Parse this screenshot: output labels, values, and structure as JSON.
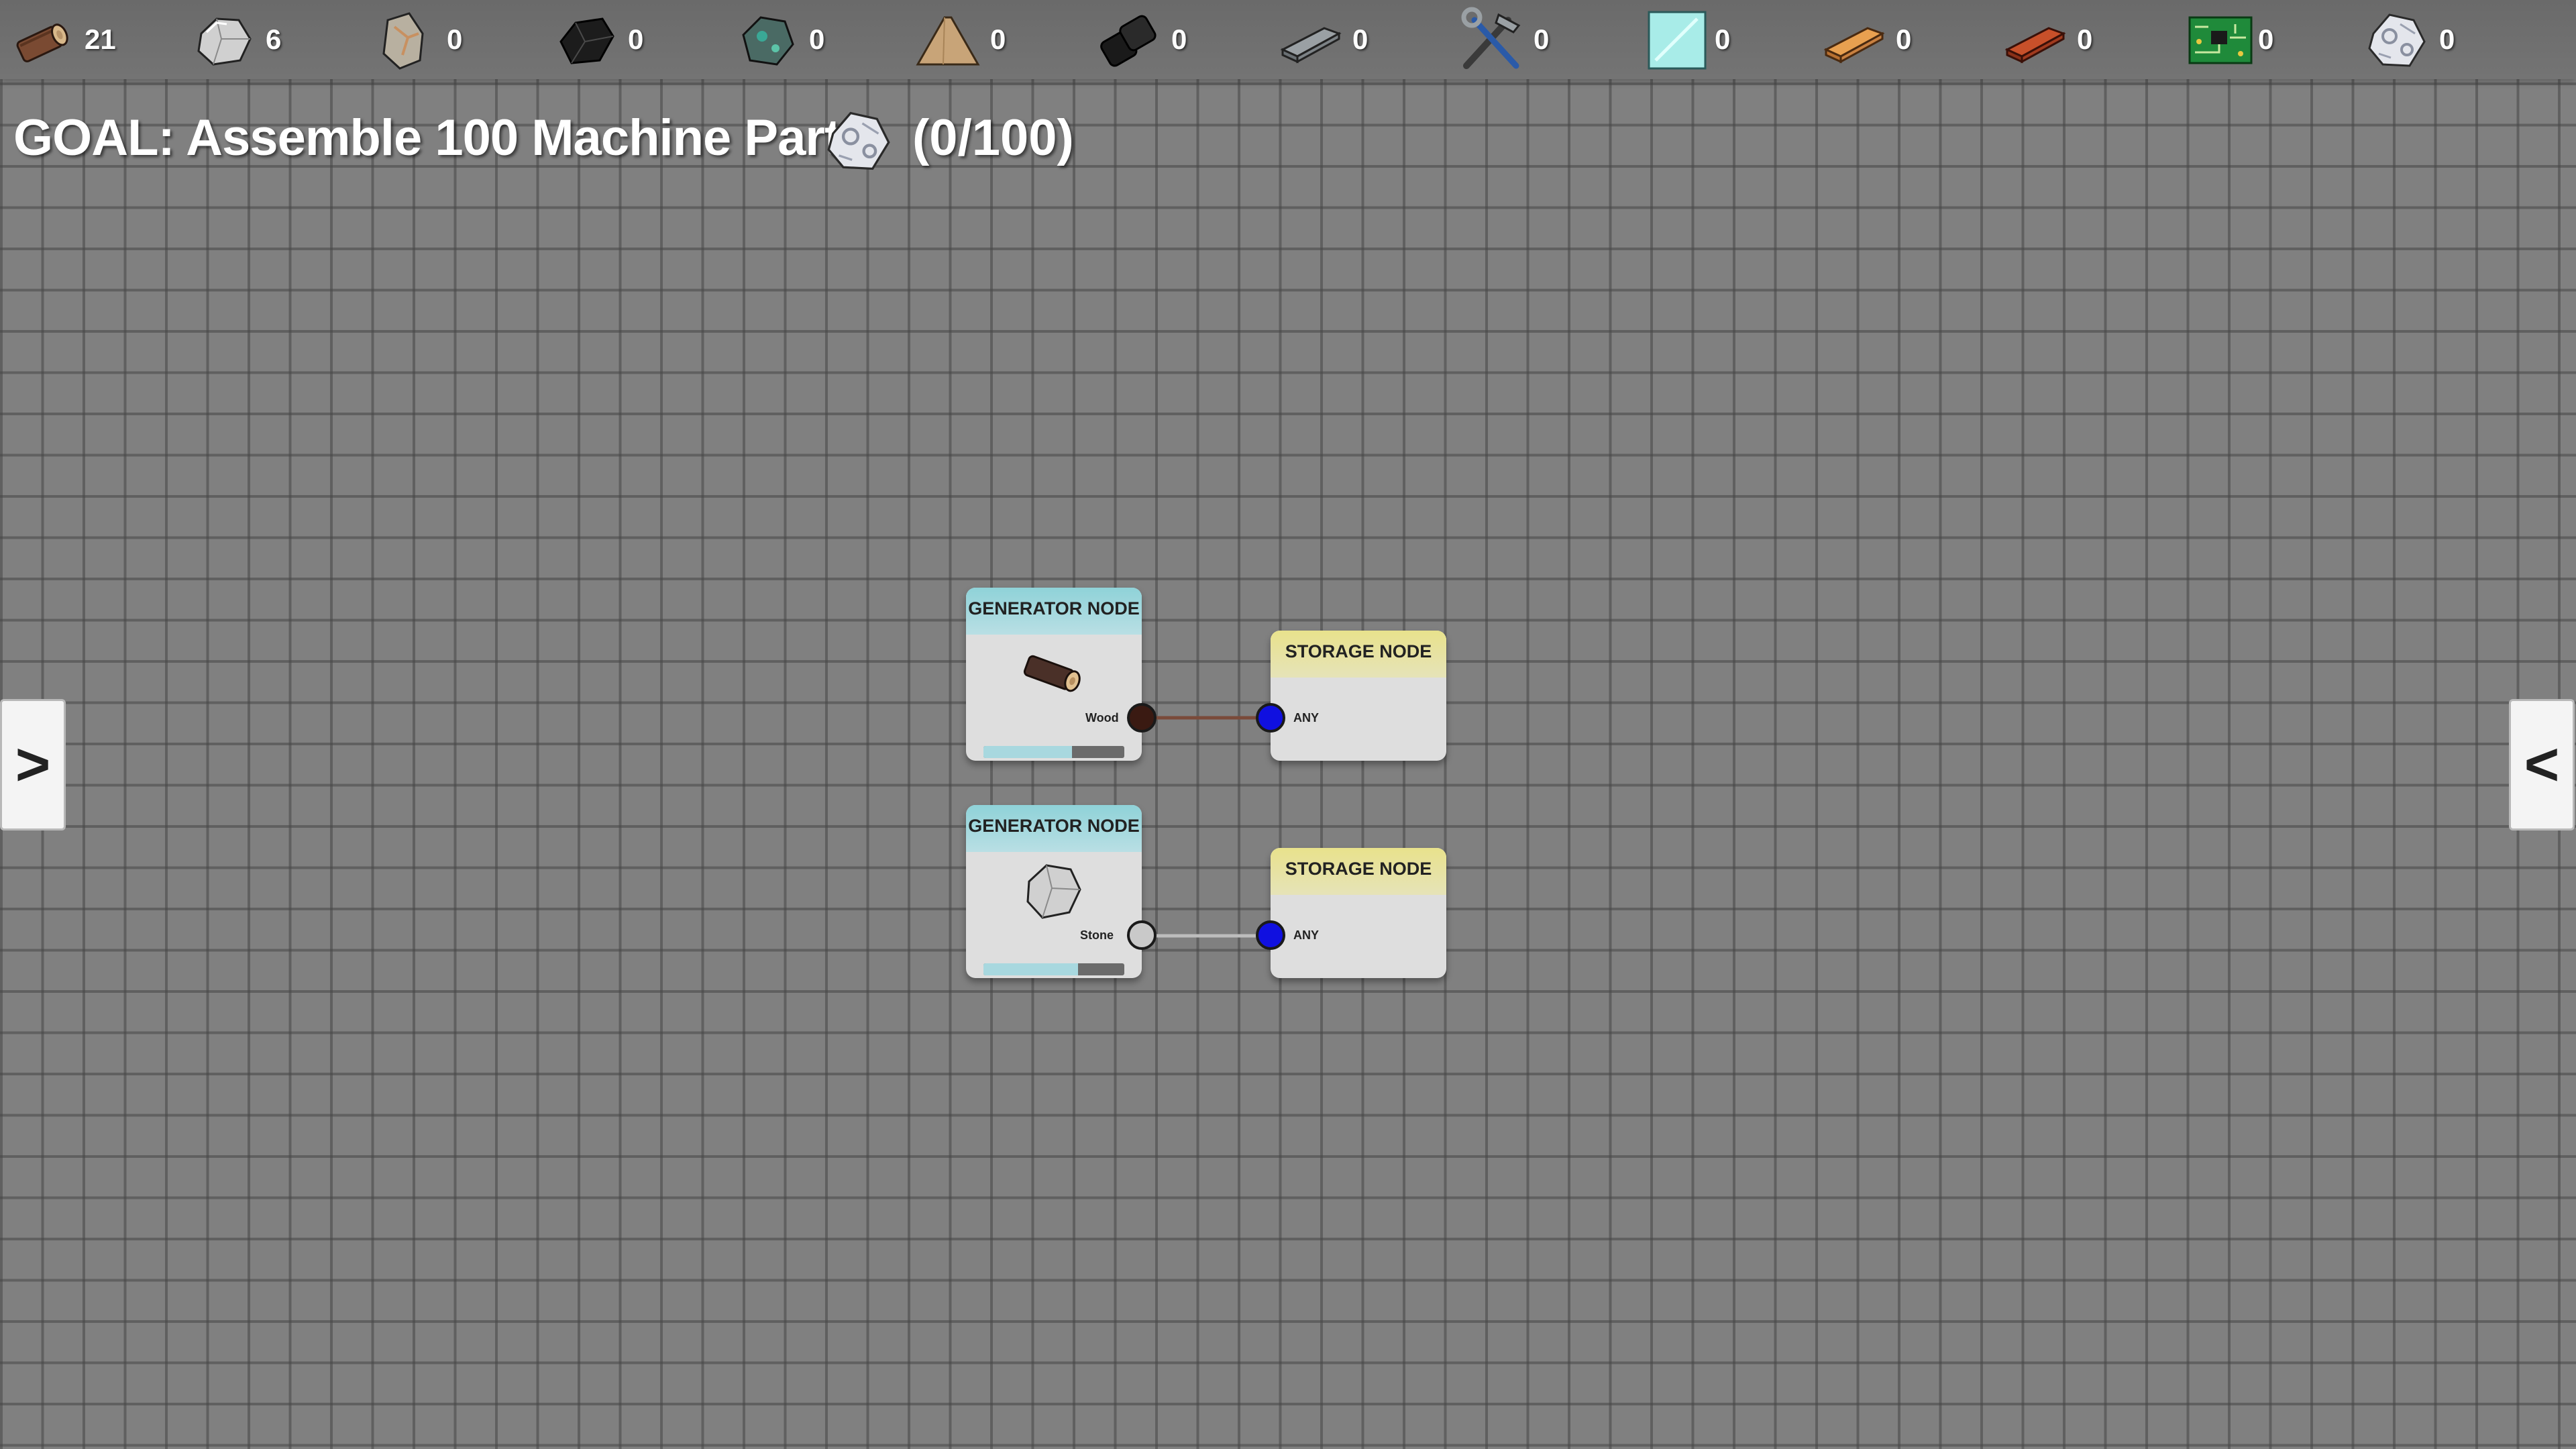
{
  "resources": [
    {
      "name": "wood-icon",
      "count": "21"
    },
    {
      "name": "stone-icon",
      "count": "6"
    },
    {
      "name": "iron-ore-icon",
      "count": "0"
    },
    {
      "name": "coal-icon",
      "count": "0"
    },
    {
      "name": "copper-ore-icon",
      "count": "0"
    },
    {
      "name": "sand-icon",
      "count": "0"
    },
    {
      "name": "rubber-icon",
      "count": "0"
    },
    {
      "name": "iron-ingot-icon",
      "count": "0"
    },
    {
      "name": "tools-icon",
      "count": "0"
    },
    {
      "name": "glass-icon",
      "count": "0"
    },
    {
      "name": "copper-ingot-icon",
      "count": "0"
    },
    {
      "name": "brick-icon",
      "count": "0"
    },
    {
      "name": "circuit-board-icon",
      "count": "0"
    },
    {
      "name": "machine-parts-icon",
      "count": "0"
    }
  ],
  "goal": {
    "text": "GOAL: Assemble 100 Machine Parts",
    "progress": "(0/100)",
    "icon": "machine-parts-icon"
  },
  "side_tabs": {
    "left": ">",
    "right": "<"
  },
  "nodes": {
    "gen1": {
      "title": "GENERATOR NODE",
      "output": "Wood",
      "icon": "wood-icon",
      "progress": 0.63
    },
    "gen2": {
      "title": "GENERATOR NODE",
      "output": "Stone",
      "icon": "stone-icon",
      "progress": 0.67
    },
    "sto1": {
      "title": "STORAGE NODE",
      "input": "ANY"
    },
    "sto2": {
      "title": "STORAGE NODE",
      "input": "ANY"
    }
  },
  "colors": {
    "wood_port": "#3a1a12",
    "stone_port": "#c9c9c9",
    "storage_port": "#1010e0",
    "generator_header": "#8fd2d8",
    "storage_header": "#e8e28c"
  }
}
